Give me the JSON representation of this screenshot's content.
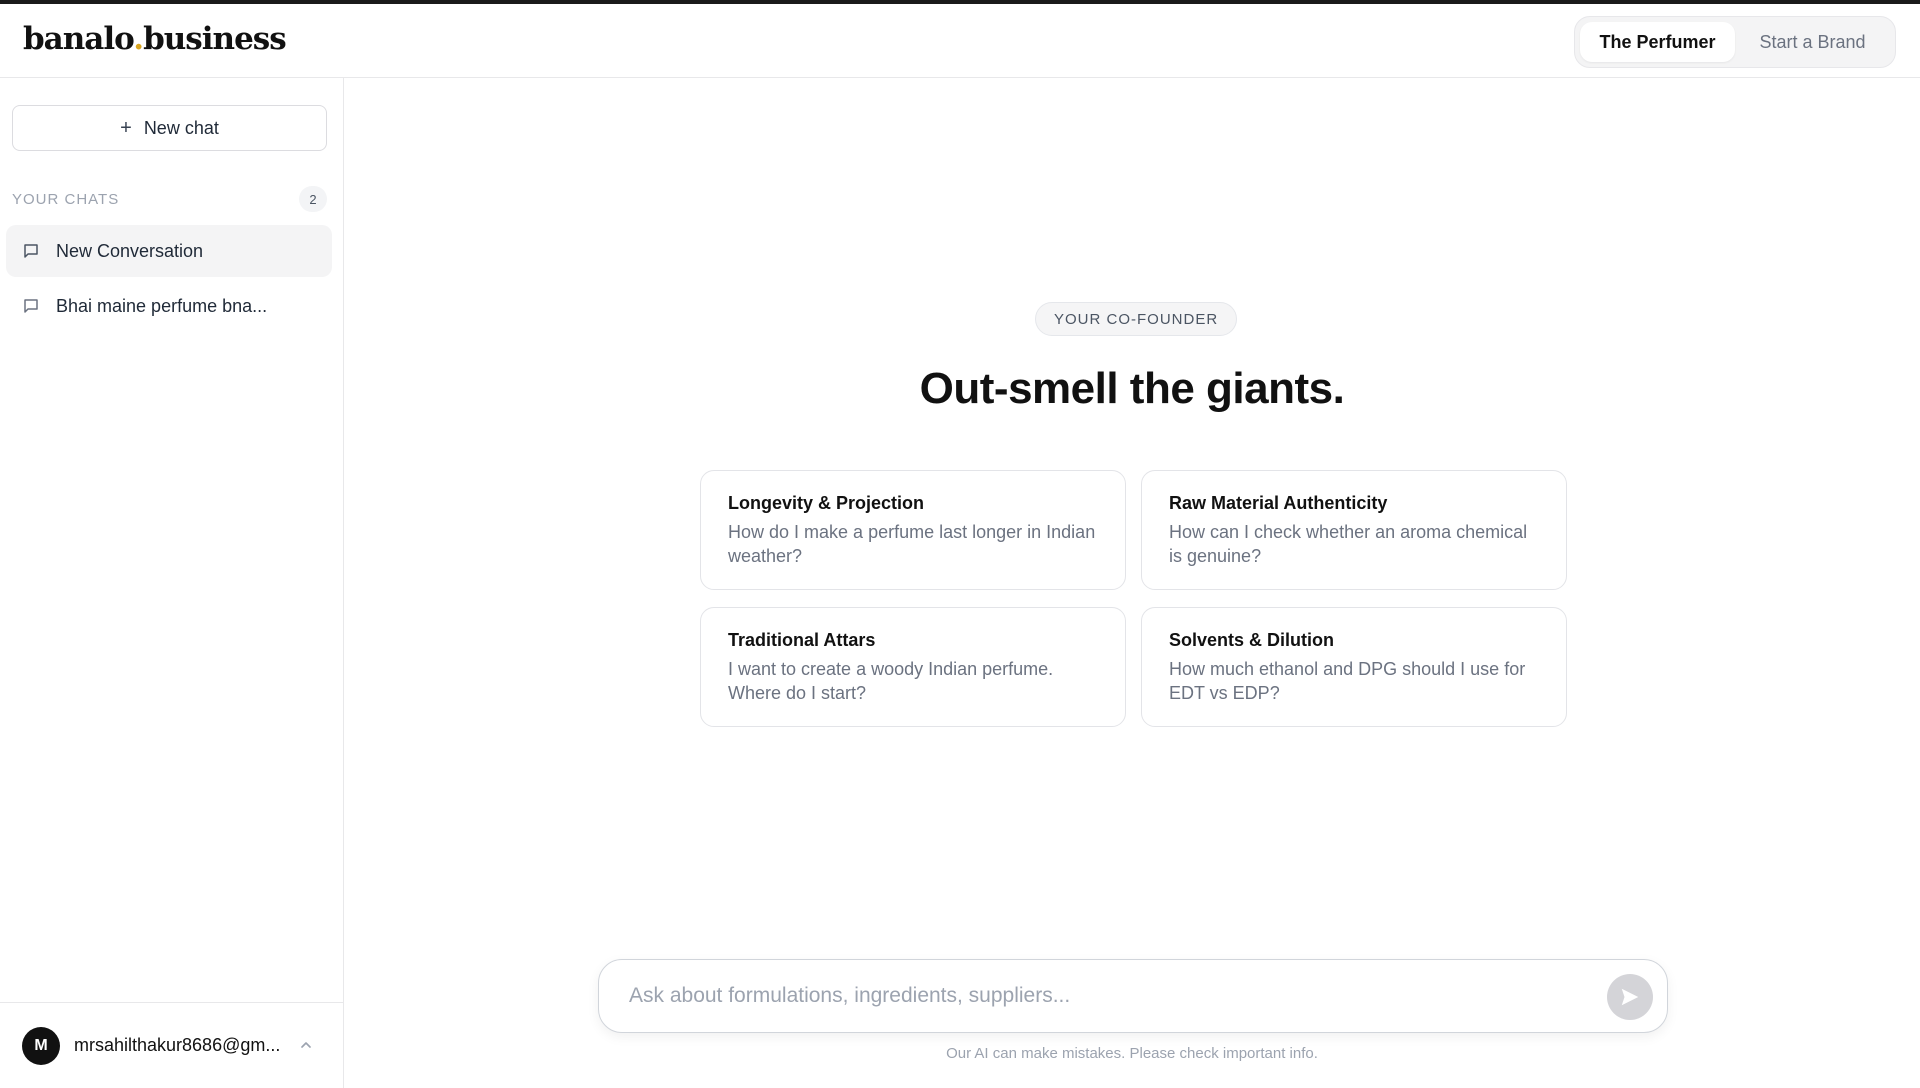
{
  "header": {
    "logo_left": "banalo",
    "logo_dot": ".",
    "logo_right": "business",
    "tabs": [
      {
        "label": "The Perfumer",
        "active": true
      },
      {
        "label": "Start a Brand",
        "active": false
      }
    ]
  },
  "sidebar": {
    "new_chat_label": "New chat",
    "chats_label": "YOUR CHATS",
    "chats_count": "2",
    "chats": [
      {
        "title": "New Conversation",
        "active": true
      },
      {
        "title": "Bhai maine perfume bna...",
        "active": false
      }
    ],
    "user": {
      "initial": "M",
      "email": "mrsahilthakur8686@gm..."
    }
  },
  "main": {
    "badge": "YOUR CO-FOUNDER",
    "headline": "Out-smell the giants.",
    "cards": [
      {
        "title": "Longevity & Projection",
        "body": "How do I make a perfume last longer in Indian weather?"
      },
      {
        "title": "Raw Material Authenticity",
        "body": "How can I check whether an aroma chemical is genuine?"
      },
      {
        "title": "Traditional Attars",
        "body": "I want to create a woody Indian perfume. Where do I start?"
      },
      {
        "title": "Solvents & Dilution",
        "body": "How much ethanol and DPG should I use for EDT vs EDP?"
      }
    ],
    "composer": {
      "placeholder": "Ask about formulations, ingredients, suppliers...",
      "value": ""
    },
    "disclaimer": "Our AI can make mistakes. Please check important info."
  },
  "colors": {
    "accent_dot": "#d9a520",
    "text_primary": "#111111",
    "text_muted": "#6b7280"
  },
  "icons": [
    "plus-icon",
    "message-icon",
    "chevron-up-icon",
    "send-icon"
  ]
}
